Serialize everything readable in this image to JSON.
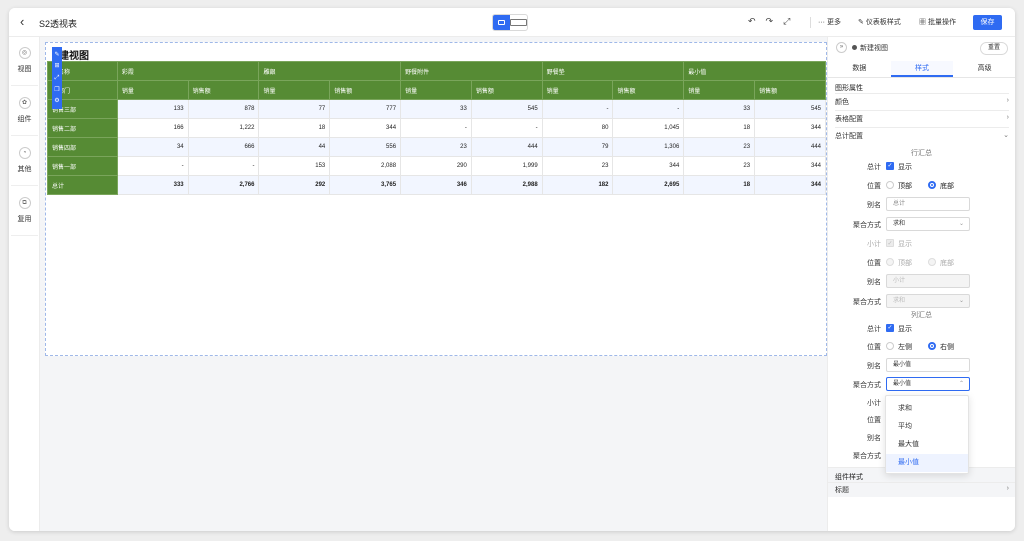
{
  "app": {
    "back_icon": "‹",
    "title": "S2透视表",
    "device_icons": [
      "desktop-icon",
      "tablet-icon"
    ],
    "top_actions": [
      {
        "name": "undo-icon",
        "glyph": "↶"
      },
      {
        "name": "redo-icon",
        "glyph": "↷"
      },
      {
        "name": "fullscreen-icon",
        "glyph": "⤢"
      }
    ],
    "more_label": "··· 更多",
    "dashboard_style_label": "仪表板样式",
    "batch_label": "批量操作",
    "save_label": "保存"
  },
  "sidebar": {
    "items": [
      {
        "label": "视图",
        "icon": "view-icon"
      },
      {
        "label": "组件",
        "icon": "component-icon"
      },
      {
        "label": "其他",
        "icon": "other-icon"
      },
      {
        "label": "复用",
        "icon": "reuse-icon"
      }
    ]
  },
  "chart": {
    "title": "建视图",
    "corner": [
      "品名称",
      "售部门"
    ],
    "products": [
      "彩霞",
      "雕銀",
      "野餐附件",
      "野餐垫",
      "最小值"
    ],
    "measures": [
      "销量",
      "销售额"
    ],
    "rows": [
      {
        "label": "销售三部",
        "values": [
          "133",
          "878",
          "77",
          "777",
          "33",
          "545",
          "-",
          "-",
          "33",
          "545"
        ]
      },
      {
        "label": "销售二部",
        "values": [
          "166",
          "1,222",
          "18",
          "344",
          "-",
          "-",
          "80",
          "1,045",
          "18",
          "344"
        ]
      },
      {
        "label": "销售四部",
        "values": [
          "34",
          "666",
          "44",
          "556",
          "23",
          "444",
          "79",
          "1,306",
          "23",
          "444"
        ]
      },
      {
        "label": "销售一部",
        "values": [
          "-",
          "-",
          "153",
          "2,088",
          "290",
          "1,999",
          "23",
          "344",
          "23",
          "344"
        ]
      },
      {
        "label": "总计",
        "values": [
          "333",
          "2,766",
          "292",
          "3,765",
          "346",
          "2,988",
          "182",
          "2,695",
          "18",
          "344"
        ]
      }
    ]
  },
  "panel": {
    "title": "新建视图",
    "reset_label": "重置",
    "tabs": [
      "数据",
      "样式",
      "高级"
    ],
    "active_tab": "样式",
    "section_graph": "图形属性",
    "color_label": "颜色",
    "table_cfg_label": "表格配置",
    "total_cfg_label": "总计配置",
    "row_total": {
      "group_title": "行汇总",
      "total_label": "总计",
      "show_label": "显示",
      "position_label": "位置",
      "pos_top": "顶部",
      "pos_bottom": "底部",
      "alias_label": "别名",
      "alias_placeholder": "总计",
      "agg_label": "聚合方式",
      "agg_value": "求和",
      "subtotal_label": "小计",
      "sub_show_label": "显示",
      "sub_position_label": "位置",
      "sub_pos_top": "顶部",
      "sub_pos_bottom": "底部",
      "sub_alias_label": "别名",
      "sub_alias_placeholder": "小计",
      "sub_agg_label": "聚合方式",
      "sub_agg_value": "求和"
    },
    "col_total": {
      "group_title": "列汇总",
      "total_label": "总计",
      "show_label": "显示",
      "position_label": "位置",
      "pos_left": "左侧",
      "pos_right": "右侧",
      "alias_label": "别名",
      "alias_value": "最小值",
      "agg_label": "聚合方式",
      "agg_value": "最小值",
      "subtotal_label": "小计",
      "sub_position_label": "位置",
      "sub_alias_label": "别名",
      "sub_agg_label": "聚合方式"
    },
    "dropdown_options": [
      "求和",
      "平均",
      "最大值",
      "最小值"
    ],
    "dropdown_selected": "最小值",
    "component_style_label": "组件样式",
    "title_label": "标题"
  }
}
